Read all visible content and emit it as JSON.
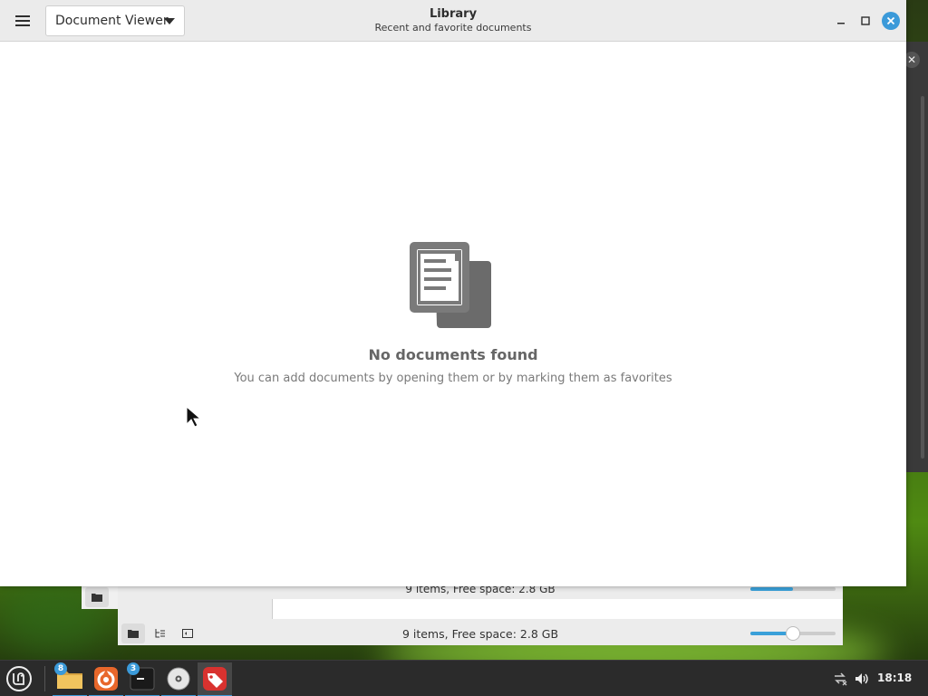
{
  "window": {
    "title": "Library",
    "subtitle": "Recent and favorite documents",
    "app_switcher": "Document Viewer"
  },
  "empty_state": {
    "title": "No documents found",
    "description": "You can add documents by opening them or by marking them as favorites"
  },
  "background_file_manager": {
    "status_back": "9 items, Free space: 2.8 GB",
    "status_front": "9 items, Free space: 2.8 GB",
    "zoom_level": 0.5
  },
  "taskbar": {
    "files_badge": "8",
    "terminal_badge": "3",
    "clock": "18:18"
  },
  "icons": {
    "menu": "hamburger-icon",
    "documents": "documents-icon",
    "accent": "#3b9ad9"
  }
}
